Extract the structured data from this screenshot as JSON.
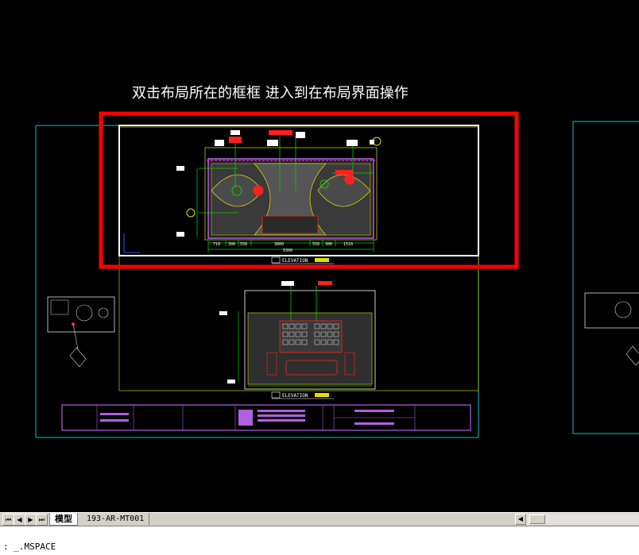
{
  "annotation": "双击布局所在的框框 进入到在布局界面操作",
  "drawing": {
    "elevation_label_1": "ELEVATION",
    "elevation_label_2": "ELEVATION",
    "dim_total": "5300",
    "dim_center": "3800",
    "dims_left": [
      "710",
      "300",
      "550"
    ],
    "dims_right": [
      "550",
      "300",
      "1510"
    ],
    "colors": {
      "highlight_box": "#ff0000",
      "viewport_frame": "#ffffff",
      "sheet_border": "#00c8c8",
      "title_block": "#b060e0",
      "drawing_yellow": "#e0e000",
      "drawing_green": "#00d000",
      "drawing_red": "#ff2020"
    }
  },
  "tabs": {
    "model": "模型",
    "layout": "193-AR-MT001"
  },
  "nav_buttons": [
    "⏮",
    "◀",
    "▶",
    "⏭"
  ],
  "command_line": {
    "prompt": ":",
    "text": "_.MSPACE"
  }
}
